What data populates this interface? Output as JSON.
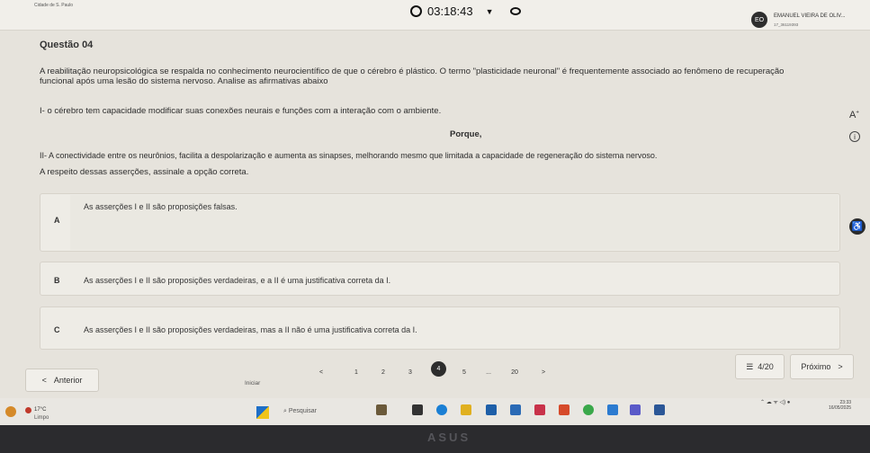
{
  "header": {
    "brand": "Cidade de S. Paulo",
    "timer": "03:18:43",
    "user_initials": "EO",
    "user_name": "EMANUEL VIEIRA DE OLIV...",
    "user_id": "17_36119393"
  },
  "question": {
    "title": "Questão 04",
    "paragraph_1": "A reabilitação neuropsicológica se respalda no conhecimento neurocientífico de que o cérebro é plástico. O termo \"plasticidade neuronal\" é frequentemente associado ao fenômeno de recuperação",
    "paragraph_1b": "funcional após uma lesão do sistema nervoso. Analise as afirmativas abaixo",
    "statement_1": "I- o cérebro tem capacidade modificar suas conexões neurais e funções com a interação com o ambiente.",
    "connector": "Porque,",
    "statement_2": "II- A conectividade entre os neurônios, facilita a despolarização e aumenta as sinapses, melhorando mesmo que limitada a capacidade de regeneração do sistema nervoso.",
    "prompt": "A respeito dessas asserções, assinale a opção correta."
  },
  "options": [
    {
      "letter": "A",
      "text": "As asserções I e II são proposições falsas."
    },
    {
      "letter": "B",
      "text": "As asserções I e II são proposições verdadeiras, e a II é uma justificativa correta da I."
    },
    {
      "letter": "C",
      "text": "As asserções I e II são proposições verdadeiras, mas a II não é uma justificativa correta da I."
    }
  ],
  "tools": {
    "font_size": "A",
    "font_size_sup": "+",
    "info": "i",
    "accessibility": "♿"
  },
  "nav": {
    "prev_label": "Anterior",
    "prev_arrow": "<",
    "start_label": "Iniciar",
    "pages": [
      "<",
      "1",
      "2",
      "3",
      "4",
      "5",
      "...",
      "20",
      ">"
    ],
    "current_page": "4",
    "counter": "4/20",
    "next_label": "Próximo",
    "next_arrow": ">"
  },
  "taskbar": {
    "temperature": "17°C",
    "condition": "Limpo",
    "search_placeholder": "Pesquisar",
    "time": "23:33",
    "date": "16/05/2025"
  },
  "bezel": {
    "logo": "ASUS"
  },
  "colors": {
    "background": "#e6e3dc",
    "active_page": "#2d2d2d",
    "option_bg": "#eeece6"
  }
}
